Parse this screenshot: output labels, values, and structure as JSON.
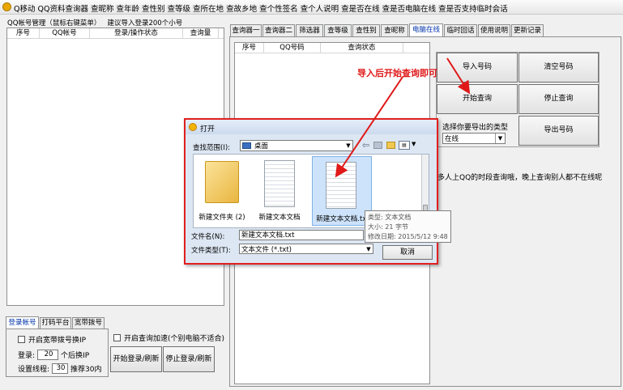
{
  "window": {
    "title": "Q移动 QQ资料查询器 查昵称 查年龄 查性别 查等级 查所在地 查故乡地 查个性签名 查个人说明 查是否在线 查是否电脑在线 查是否支持临时会话"
  },
  "left_panel": {
    "group_title": "QQ帐号管理（鼠标右键菜单）   建议导入登录200个小号",
    "columns": [
      "序号",
      "QQ帐号",
      "登录/操作状态",
      "查询量"
    ],
    "tabs": [
      "登录帐号",
      "打码平台",
      "宽带拨号"
    ],
    "broadband_checkbox": "开启宽带拨号换IP",
    "query_speedup_checkbox": "开启查询加速(个别电脑不适合)",
    "login_label": "登录:",
    "login_value": "20",
    "login_suffix": "个后换IP",
    "threads_label": "设置线程:",
    "threads_value": "30",
    "threads_suffix": "推荐30内",
    "start_login_button": "开始登录/刷新",
    "stop_login_button": "停止登录/刷新"
  },
  "right_panel": {
    "tabs": [
      "查询器一",
      "查询器二",
      "筛选器",
      "查等级",
      "查性别",
      "查昵称",
      "电脑在线",
      "临时回话",
      "使用说明",
      "更新记录"
    ],
    "active_tab": "电脑在线",
    "columns": [
      "序号",
      "QQ号码",
      "查询状态"
    ],
    "import_button": "导入号码",
    "clear_button": "清空号码",
    "start_button": "开始查询",
    "stop_button": "停止查询",
    "export_type_label": "选择你要导出的类型",
    "export_type_value": "在线",
    "export_button": "导出号码",
    "info_text": "多人上QQ的时段查询哦，晚上查询别人都不在线呢"
  },
  "annotation": {
    "text": "导入后开始查询即可",
    "color": "#e01818"
  },
  "open_dialog": {
    "title": "打开",
    "lookin_label": "查找范围(I):",
    "lookin_value": "桌面",
    "files": [
      {
        "name": "新建文件夹 (2)",
        "type": "folder"
      },
      {
        "name": "新建文本文档",
        "type": "text"
      },
      {
        "name": "新建文本文档.txt",
        "type": "text",
        "selected": true
      }
    ],
    "tooltip": {
      "type": "类型: 文本文档",
      "size": "大小: 21 字节",
      "modified": "修改日期: 2015/5/12 9:48"
    },
    "filename_label": "文件名(N):",
    "filename_value": "新建文本文档.txt",
    "filetype_label": "文件类型(T):",
    "filetype_value": "文本文件 (*.txt)",
    "cancel_button": "取消"
  }
}
